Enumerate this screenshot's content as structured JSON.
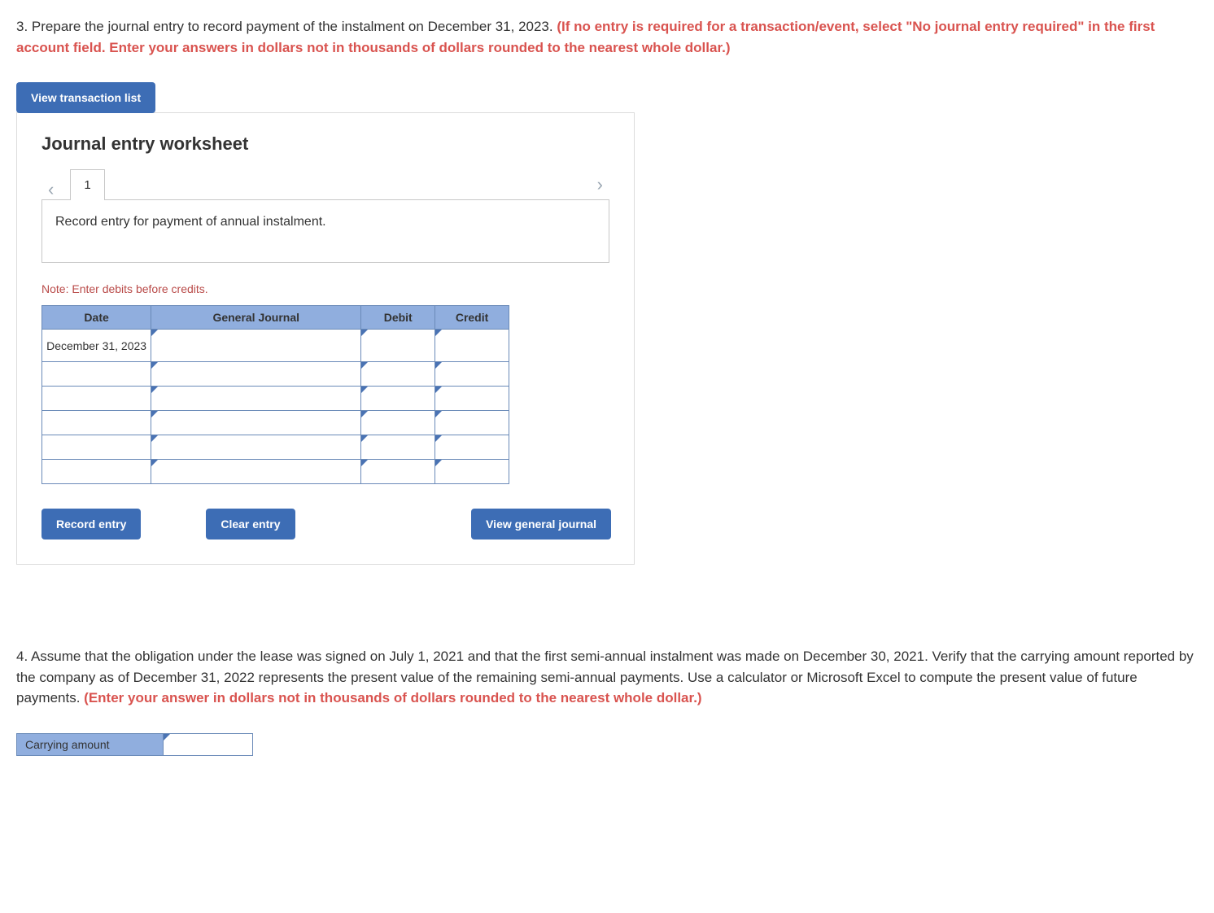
{
  "question3": {
    "number": "3.",
    "text_pre": " Prepare the journal entry to record payment of the instalment on December 31, 2023. ",
    "red_text": "(If no entry is required for a transaction/event, select \"No journal entry required\" in the first account field. Enter your answers in dollars not in thousands of dollars rounded to the nearest whole dollar.)"
  },
  "buttons": {
    "view_transaction_list": "View transaction list",
    "record_entry": "Record entry",
    "clear_entry": "Clear entry",
    "view_general_journal": "View general journal"
  },
  "worksheet": {
    "title": "Journal entry worksheet",
    "tab_number": "1",
    "instruction": "Record entry for payment of annual instalment.",
    "note": "Note: Enter debits before credits.",
    "headers": {
      "date": "Date",
      "general_journal": "General Journal",
      "debit": "Debit",
      "credit": "Credit"
    },
    "rows": [
      {
        "date": "December 31, 2023",
        "gj": "",
        "debit": "",
        "credit": ""
      },
      {
        "date": "",
        "gj": "",
        "debit": "",
        "credit": ""
      },
      {
        "date": "",
        "gj": "",
        "debit": "",
        "credit": ""
      },
      {
        "date": "",
        "gj": "",
        "debit": "",
        "credit": ""
      },
      {
        "date": "",
        "gj": "",
        "debit": "",
        "credit": ""
      },
      {
        "date": "",
        "gj": "",
        "debit": "",
        "credit": ""
      }
    ]
  },
  "question4": {
    "number": "4.",
    "text_pre": " Assume that the obligation under the lease was signed on July 1, 2021 and that the first semi-annual instalment was made on December 30, 2021. Verify that the carrying amount reported by the company as of December 31, 2022 represents the present value of the remaining semi-annual payments. Use a calculator or Microsoft Excel to compute the present value of future payments. ",
    "red_text": "(Enter your answer in dollars not in thousands of dollars rounded to the nearest whole dollar.)",
    "carrying_label": "Carrying amount",
    "carrying_value": ""
  }
}
